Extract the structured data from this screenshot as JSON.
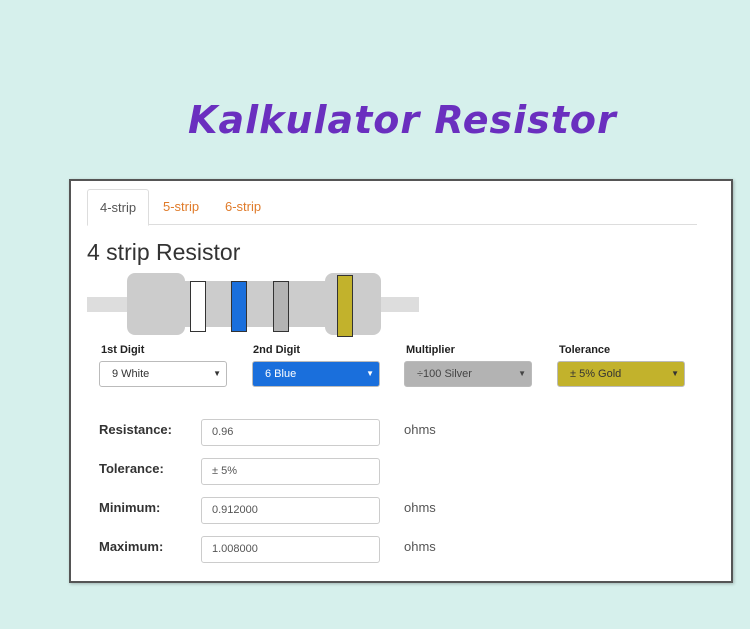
{
  "app_title": "Kalkulator Resistor",
  "tabs": [
    {
      "label": "4-strip",
      "active": true
    },
    {
      "label": "5-strip",
      "active": false
    },
    {
      "label": "6-strip",
      "active": false
    }
  ],
  "heading": "4 strip Resistor",
  "bands": {
    "digit1": {
      "label": "1st Digit",
      "value": "9 White",
      "color": "#ffffff",
      "text_color": "#333333"
    },
    "digit2": {
      "label": "2nd Digit",
      "value": "6 Blue",
      "color": "#1a6fdc",
      "text_color": "#ffffff"
    },
    "multiplier": {
      "label": "Multiplier",
      "value": "÷100 Silver",
      "color": "#b3b3b3",
      "text_color": "#444444"
    },
    "tolerance": {
      "label": "Tolerance",
      "value": "± 5% Gold",
      "color": "#c2b22c",
      "text_color": "#333333"
    }
  },
  "results": {
    "resistance": {
      "label": "Resistance:",
      "value": "0.96",
      "unit": "ohms"
    },
    "tolerance": {
      "label": "Tolerance:",
      "value": "± 5%",
      "unit": ""
    },
    "minimum": {
      "label": "Minimum:",
      "value": "0.912000",
      "unit": "ohms"
    },
    "maximum": {
      "label": "Maximum:",
      "value": "1.008000",
      "unit": "ohms"
    }
  }
}
